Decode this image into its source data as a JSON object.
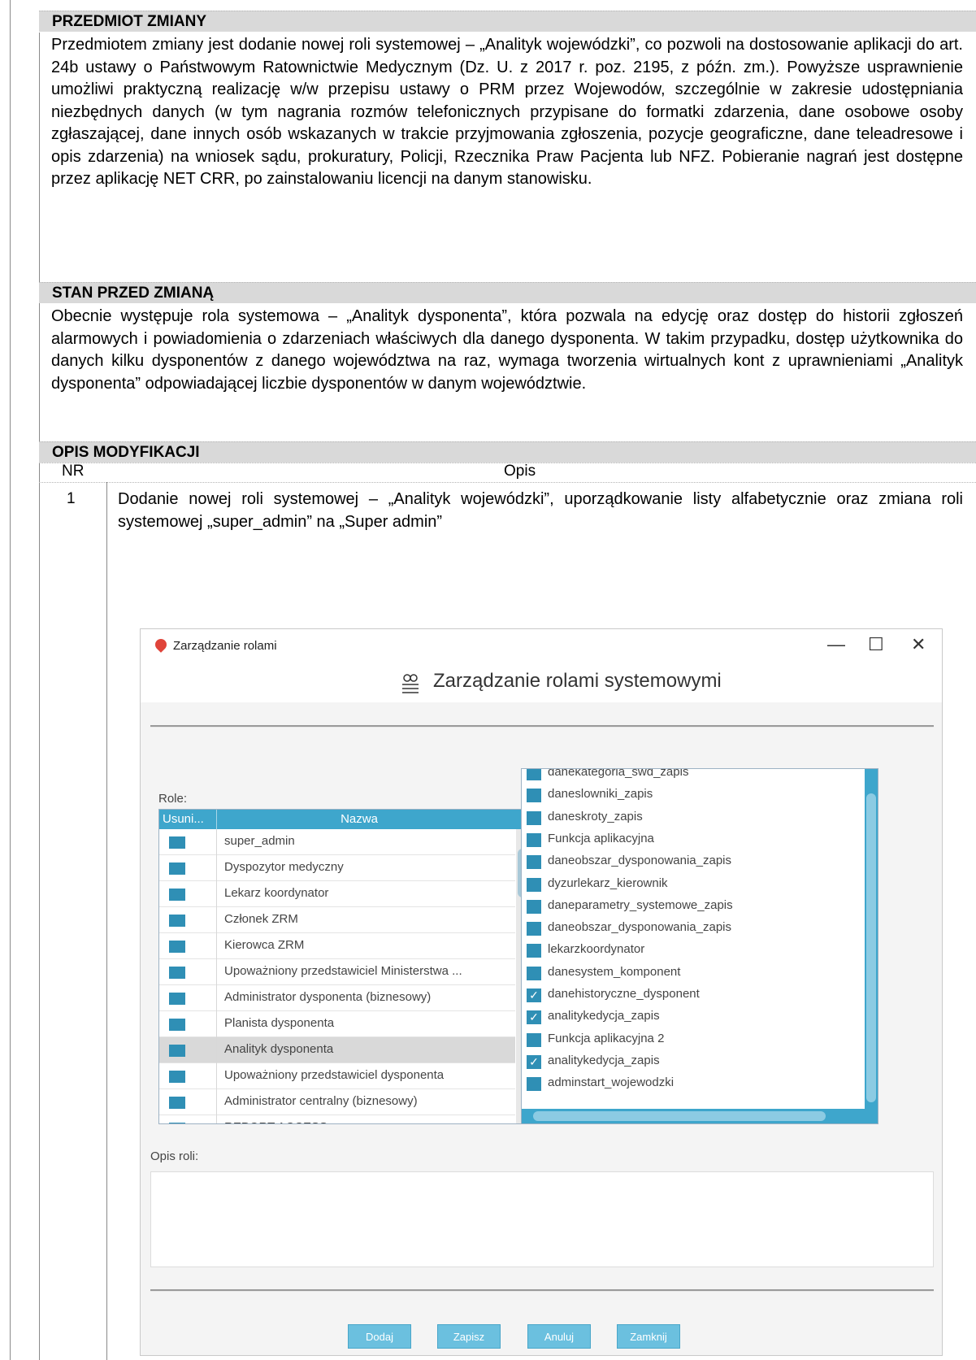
{
  "sections": {
    "subject": {
      "heading": "PRZEDMIOT ZMIANY",
      "text": "Przedmiotem zmiany jest dodanie nowej roli systemowej – „Analityk wojewódzki”, co pozwoli na dostosowanie aplikacji do art. 24b ustawy o Państwowym Ratownictwie Medycznym (Dz. U. z 2017 r. poz. 2195, z późn. zm.). Powyższe usprawnienie umożliwi praktyczną realizację w/w przepisu ustawy o PRM przez Wojewodów, szczególnie w zakresie udostępniania niezbędnych danych (w tym nagrania rozmów telefonicznych przypisane do formatki zdarzenia, dane osobowe osoby zgłaszającej, dane innych osób wskazanych w trakcie przyjmowania zgłoszenia, pozycje geograficzne, dane teleadresowe i opis zdarzenia) na wniosek sądu, prokuratury, Policji, Rzecznika Praw Pacjenta lub NFZ. Pobieranie nagrań jest dostępne przez aplikację NET CRR, po zainstalowaniu licencji na danym stanowisku."
    },
    "before": {
      "heading": "STAN PRZED ZMIANĄ",
      "text": "Obecnie występuje rola systemowa – „Analityk dysponenta”, która pozwala na edycję oraz dostęp do historii zgłoszeń alarmowych i powiadomienia o zdarzeniach właściwych dla danego dysponenta. W takim przypadku, dostęp użytkownika do danych kilku dysponentów z danego województwa na raz, wymaga tworzenia wirtualnych kont z uprawnieniami „Analityk dysponenta” odpowiadającej liczbie dysponentów w danym województwie."
    },
    "modification": {
      "heading": "OPIS MODYFIKACJI",
      "col_nr": "NR",
      "col_desc": "Opis",
      "row_nr": "1",
      "row_text": "Dodanie nowej roli systemowej – „Analityk wojewódzki”, uporządkowanie listy alfabetycznie oraz zmiana roli systemowej „super_admin” na „Super admin”"
    }
  },
  "window": {
    "title": "Zarządzanie rolami",
    "minimize": "—",
    "maximize": "☐",
    "close": "✕",
    "header": "Zarządzanie rolami systemowymi",
    "roles_label": "Role:",
    "col_deleted": "Usuni...",
    "col_name": "Nazwa",
    "roles": [
      "super_admin",
      "Dyspozytor medyczny",
      "Lekarz koordynator",
      "Członek ZRM",
      "Kierowca ZRM",
      "Upoważniony przedstawiciel Ministerstwa ...",
      "Administrator dysponenta (biznesowy)",
      "Planista dysponenta",
      "Analityk dysponenta",
      "Upoważniony przedstawiciel dysponenta",
      "Administrator centralny (biznesowy)",
      "REPORT ACCESS"
    ],
    "selected_role": "Analityk dysponenta",
    "permissions": [
      {
        "label": "danekategoria_swd_zapis",
        "checked": false
      },
      {
        "label": "daneslowniki_zapis",
        "checked": false
      },
      {
        "label": "daneskroty_zapis",
        "checked": false
      },
      {
        "label": "Funkcja aplikacyjna",
        "checked": false
      },
      {
        "label": "daneobszar_dysponowania_zapis",
        "checked": false
      },
      {
        "label": "dyzurlekarz_kierownik",
        "checked": false
      },
      {
        "label": "daneparametry_systemowe_zapis",
        "checked": false
      },
      {
        "label": "daneobszar_dysponowania_zapis",
        "checked": false
      },
      {
        "label": "lekarzkoordynator",
        "checked": false
      },
      {
        "label": "danesystem_komponent",
        "checked": false
      },
      {
        "label": "danehistoryczne_dysponent",
        "checked": true
      },
      {
        "label": "analitykedycja_zapis",
        "checked": true
      },
      {
        "label": "Funkcja aplikacyjna 2",
        "checked": false
      },
      {
        "label": "analitykedycja_zapis",
        "checked": true
      },
      {
        "label": "adminstart_wojewodzki",
        "checked": false
      }
    ],
    "desc_label": "Opis roli:",
    "buttons": {
      "add": "Dodaj",
      "save": "Zapisz",
      "cancel": "Anuluj",
      "close": "Zamknij"
    }
  }
}
